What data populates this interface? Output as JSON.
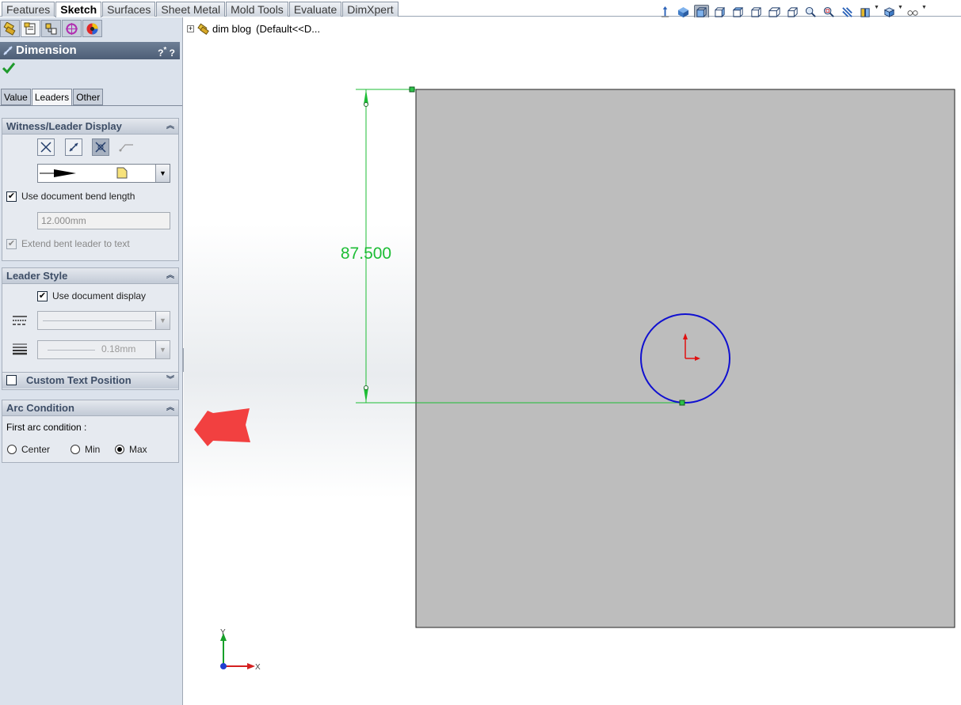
{
  "command_tabs": [
    {
      "label": "Features",
      "active": false
    },
    {
      "label": "Sketch",
      "active": true
    },
    {
      "label": "Surfaces",
      "active": false
    },
    {
      "label": "Sheet Metal",
      "active": false
    },
    {
      "label": "Mold Tools",
      "active": false
    },
    {
      "label": "Evaluate",
      "active": false
    },
    {
      "label": "DimXpert",
      "active": false
    }
  ],
  "hud_icons": [
    "normal-to-icon",
    "view-orientation-icon",
    "front-view-icon",
    "right-view-icon",
    "top-view-icon",
    "isometric-view-icon",
    "trimetric-view-icon",
    "dimetric-view-icon",
    "zoom-to-fit-icon",
    "zoom-to-area-icon",
    "section-view-icon",
    "display-style-icon",
    "hide-show-icon",
    "edit-appearance-icon"
  ],
  "property_manager": {
    "title": "Dimension",
    "help": "?",
    "pin": "*",
    "subtabs": [
      "Value",
      "Leaders",
      "Other"
    ],
    "active_subtab": "Leaders",
    "witness_leader": {
      "title": "Witness/Leader Display",
      "use_doc_bend_label": "Use document bend length",
      "use_doc_bend_checked": true,
      "bend_length": "12.000mm",
      "extend_bent_label": "Extend bent leader to text",
      "extend_bent_checked": true
    },
    "leader_style": {
      "title": "Leader Style",
      "use_doc_display_label": "Use document display",
      "use_doc_display_checked": true,
      "thickness_value": "0.18mm"
    },
    "custom_text": {
      "title": "Custom Text Position",
      "checked": false
    },
    "arc_condition": {
      "title": "Arc Condition",
      "first_arc_label": "First arc condition :",
      "options": [
        "Center",
        "Min",
        "Max"
      ],
      "selected": "Max"
    }
  },
  "feature_tree": {
    "name": "dim blog",
    "config": "(Default<<D..."
  },
  "dimension_value": "87.500",
  "colors": {
    "dimension": "#1dbd35",
    "circle": "#1010d0",
    "sheet": "#bdbdbd",
    "annotation_arrow": "#f24040"
  },
  "triad": {
    "x_label": "X",
    "y_label": "Y"
  }
}
